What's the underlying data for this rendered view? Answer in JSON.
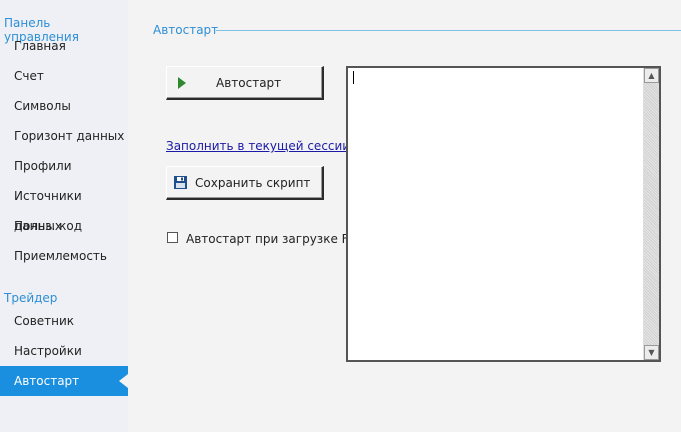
{
  "sidebar": {
    "section1_title": "Панель управления",
    "section1_items": [
      {
        "label": "Главная"
      },
      {
        "label": "Счет"
      },
      {
        "label": "Символы"
      },
      {
        "label": "Горизонт данных"
      },
      {
        "label": "Профили"
      },
      {
        "label": "Источники данных"
      },
      {
        "label": "Польз. код"
      },
      {
        "label": "Приемлемость"
      }
    ],
    "section2_title": "Трейдер",
    "section2_items": [
      {
        "label": "Советник"
      },
      {
        "label": "Настройки"
      },
      {
        "label": "Автостарт",
        "active": true
      }
    ]
  },
  "main": {
    "group_title": "Автостарт",
    "autostart_button_label": "Автостарт",
    "fill_link_label": "Заполнить в текущей сессии",
    "save_button_label": "Сохранить скрипт",
    "checkbox_label": "Автостарт при загрузке FSB",
    "checkbox_checked": false,
    "script_text": ""
  },
  "colors": {
    "accent": "#1a8fe0",
    "section_title": "#2d8fd5",
    "play_icon": "#2f8a2f",
    "save_icon": "#1f4f8a"
  },
  "icons": {
    "autostart_button": "play-icon",
    "save_button": "floppy-disk-icon"
  }
}
